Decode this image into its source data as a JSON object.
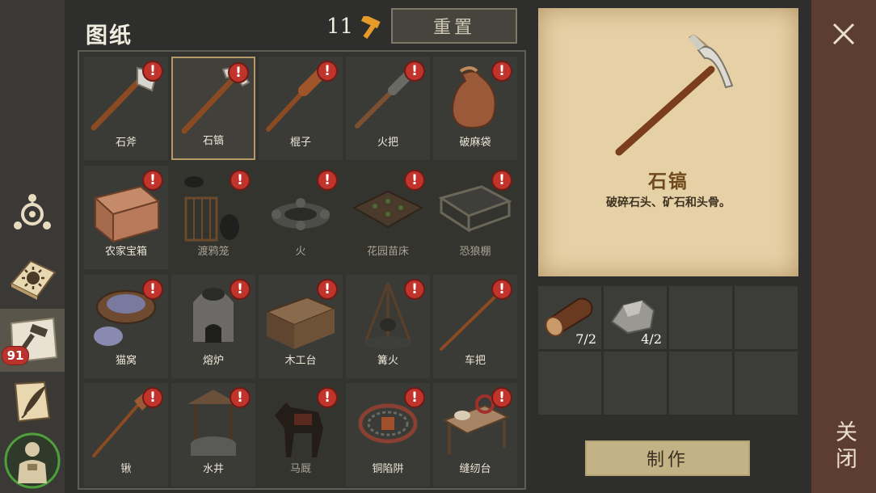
{
  "header": {
    "title": "图纸",
    "blueprint_count": "11",
    "reset_label": "重置"
  },
  "sidebar": {
    "badge_count": "91"
  },
  "items": [
    {
      "label": "石斧",
      "icon": "stone-axe-icon"
    },
    {
      "label": "石镐",
      "icon": "stone-pickaxe-icon",
      "selected": true
    },
    {
      "label": "棍子",
      "icon": "club-icon"
    },
    {
      "label": "火把",
      "icon": "torch-icon"
    },
    {
      "label": "破麻袋",
      "icon": "sack-icon"
    },
    {
      "label": "农家宝箱",
      "icon": "chest-icon"
    },
    {
      "label": "渡鸦笼",
      "icon": "raven-cage-icon"
    },
    {
      "label": "火",
      "icon": "fire-pit-icon"
    },
    {
      "label": "花园苗床",
      "icon": "garden-bed-icon"
    },
    {
      "label": "恐狼棚",
      "icon": "wolf-pen-icon"
    },
    {
      "label": "猫窝",
      "icon": "cat-bed-icon"
    },
    {
      "label": "熔炉",
      "icon": "furnace-icon"
    },
    {
      "label": "木工台",
      "icon": "workbench-icon"
    },
    {
      "label": "篝火",
      "icon": "bonfire-icon"
    },
    {
      "label": "车把",
      "icon": "cart-handle-icon"
    },
    {
      "label": "锹",
      "icon": "shovel-icon"
    },
    {
      "label": "水井",
      "icon": "well-icon"
    },
    {
      "label": "马厩",
      "icon": "stable-icon"
    },
    {
      "label": "铜陷阱",
      "icon": "bear-trap-icon"
    },
    {
      "label": "缝纫台",
      "icon": "sewing-table-icon"
    }
  ],
  "detail": {
    "name": "石镐",
    "description": "破碎石头、矿石和头骨。"
  },
  "ingredients": [
    {
      "icon": "log-icon",
      "qty": "7/2"
    },
    {
      "icon": "stone-icon",
      "qty": "4/2"
    }
  ],
  "actions": {
    "make_label": "制作",
    "close_label": "关闭"
  },
  "colors": {
    "badge": "#c1342c",
    "parchment": "#e6d1a6",
    "close_column": "#5d3d2f"
  }
}
